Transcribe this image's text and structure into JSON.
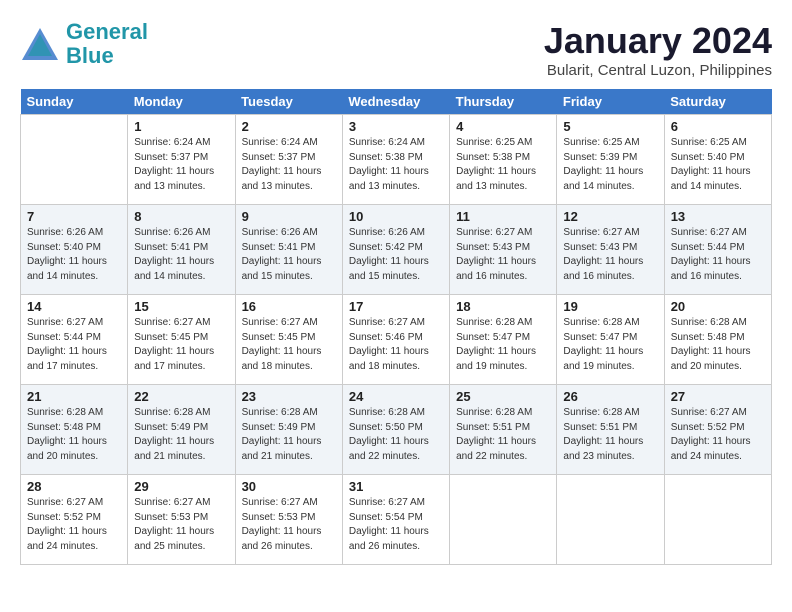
{
  "logo": {
    "line1": "General",
    "line2": "Blue"
  },
  "title": "January 2024",
  "location": "Bularit, Central Luzon, Philippines",
  "days_header": [
    "Sunday",
    "Monday",
    "Tuesday",
    "Wednesday",
    "Thursday",
    "Friday",
    "Saturday"
  ],
  "weeks": [
    [
      {
        "num": "",
        "info": ""
      },
      {
        "num": "1",
        "info": "Sunrise: 6:24 AM\nSunset: 5:37 PM\nDaylight: 11 hours\nand 13 minutes."
      },
      {
        "num": "2",
        "info": "Sunrise: 6:24 AM\nSunset: 5:37 PM\nDaylight: 11 hours\nand 13 minutes."
      },
      {
        "num": "3",
        "info": "Sunrise: 6:24 AM\nSunset: 5:38 PM\nDaylight: 11 hours\nand 13 minutes."
      },
      {
        "num": "4",
        "info": "Sunrise: 6:25 AM\nSunset: 5:38 PM\nDaylight: 11 hours\nand 13 minutes."
      },
      {
        "num": "5",
        "info": "Sunrise: 6:25 AM\nSunset: 5:39 PM\nDaylight: 11 hours\nand 14 minutes."
      },
      {
        "num": "6",
        "info": "Sunrise: 6:25 AM\nSunset: 5:40 PM\nDaylight: 11 hours\nand 14 minutes."
      }
    ],
    [
      {
        "num": "7",
        "info": "Sunrise: 6:26 AM\nSunset: 5:40 PM\nDaylight: 11 hours\nand 14 minutes."
      },
      {
        "num": "8",
        "info": "Sunrise: 6:26 AM\nSunset: 5:41 PM\nDaylight: 11 hours\nand 14 minutes."
      },
      {
        "num": "9",
        "info": "Sunrise: 6:26 AM\nSunset: 5:41 PM\nDaylight: 11 hours\nand 15 minutes."
      },
      {
        "num": "10",
        "info": "Sunrise: 6:26 AM\nSunset: 5:42 PM\nDaylight: 11 hours\nand 15 minutes."
      },
      {
        "num": "11",
        "info": "Sunrise: 6:27 AM\nSunset: 5:43 PM\nDaylight: 11 hours\nand 16 minutes."
      },
      {
        "num": "12",
        "info": "Sunrise: 6:27 AM\nSunset: 5:43 PM\nDaylight: 11 hours\nand 16 minutes."
      },
      {
        "num": "13",
        "info": "Sunrise: 6:27 AM\nSunset: 5:44 PM\nDaylight: 11 hours\nand 16 minutes."
      }
    ],
    [
      {
        "num": "14",
        "info": "Sunrise: 6:27 AM\nSunset: 5:44 PM\nDaylight: 11 hours\nand 17 minutes."
      },
      {
        "num": "15",
        "info": "Sunrise: 6:27 AM\nSunset: 5:45 PM\nDaylight: 11 hours\nand 17 minutes."
      },
      {
        "num": "16",
        "info": "Sunrise: 6:27 AM\nSunset: 5:45 PM\nDaylight: 11 hours\nand 18 minutes."
      },
      {
        "num": "17",
        "info": "Sunrise: 6:27 AM\nSunset: 5:46 PM\nDaylight: 11 hours\nand 18 minutes."
      },
      {
        "num": "18",
        "info": "Sunrise: 6:28 AM\nSunset: 5:47 PM\nDaylight: 11 hours\nand 19 minutes."
      },
      {
        "num": "19",
        "info": "Sunrise: 6:28 AM\nSunset: 5:47 PM\nDaylight: 11 hours\nand 19 minutes."
      },
      {
        "num": "20",
        "info": "Sunrise: 6:28 AM\nSunset: 5:48 PM\nDaylight: 11 hours\nand 20 minutes."
      }
    ],
    [
      {
        "num": "21",
        "info": "Sunrise: 6:28 AM\nSunset: 5:48 PM\nDaylight: 11 hours\nand 20 minutes."
      },
      {
        "num": "22",
        "info": "Sunrise: 6:28 AM\nSunset: 5:49 PM\nDaylight: 11 hours\nand 21 minutes."
      },
      {
        "num": "23",
        "info": "Sunrise: 6:28 AM\nSunset: 5:49 PM\nDaylight: 11 hours\nand 21 minutes."
      },
      {
        "num": "24",
        "info": "Sunrise: 6:28 AM\nSunset: 5:50 PM\nDaylight: 11 hours\nand 22 minutes."
      },
      {
        "num": "25",
        "info": "Sunrise: 6:28 AM\nSunset: 5:51 PM\nDaylight: 11 hours\nand 22 minutes."
      },
      {
        "num": "26",
        "info": "Sunrise: 6:28 AM\nSunset: 5:51 PM\nDaylight: 11 hours\nand 23 minutes."
      },
      {
        "num": "27",
        "info": "Sunrise: 6:27 AM\nSunset: 5:52 PM\nDaylight: 11 hours\nand 24 minutes."
      }
    ],
    [
      {
        "num": "28",
        "info": "Sunrise: 6:27 AM\nSunset: 5:52 PM\nDaylight: 11 hours\nand 24 minutes."
      },
      {
        "num": "29",
        "info": "Sunrise: 6:27 AM\nSunset: 5:53 PM\nDaylight: 11 hours\nand 25 minutes."
      },
      {
        "num": "30",
        "info": "Sunrise: 6:27 AM\nSunset: 5:53 PM\nDaylight: 11 hours\nand 26 minutes."
      },
      {
        "num": "31",
        "info": "Sunrise: 6:27 AM\nSunset: 5:54 PM\nDaylight: 11 hours\nand 26 minutes."
      },
      {
        "num": "",
        "info": ""
      },
      {
        "num": "",
        "info": ""
      },
      {
        "num": "",
        "info": ""
      }
    ]
  ]
}
